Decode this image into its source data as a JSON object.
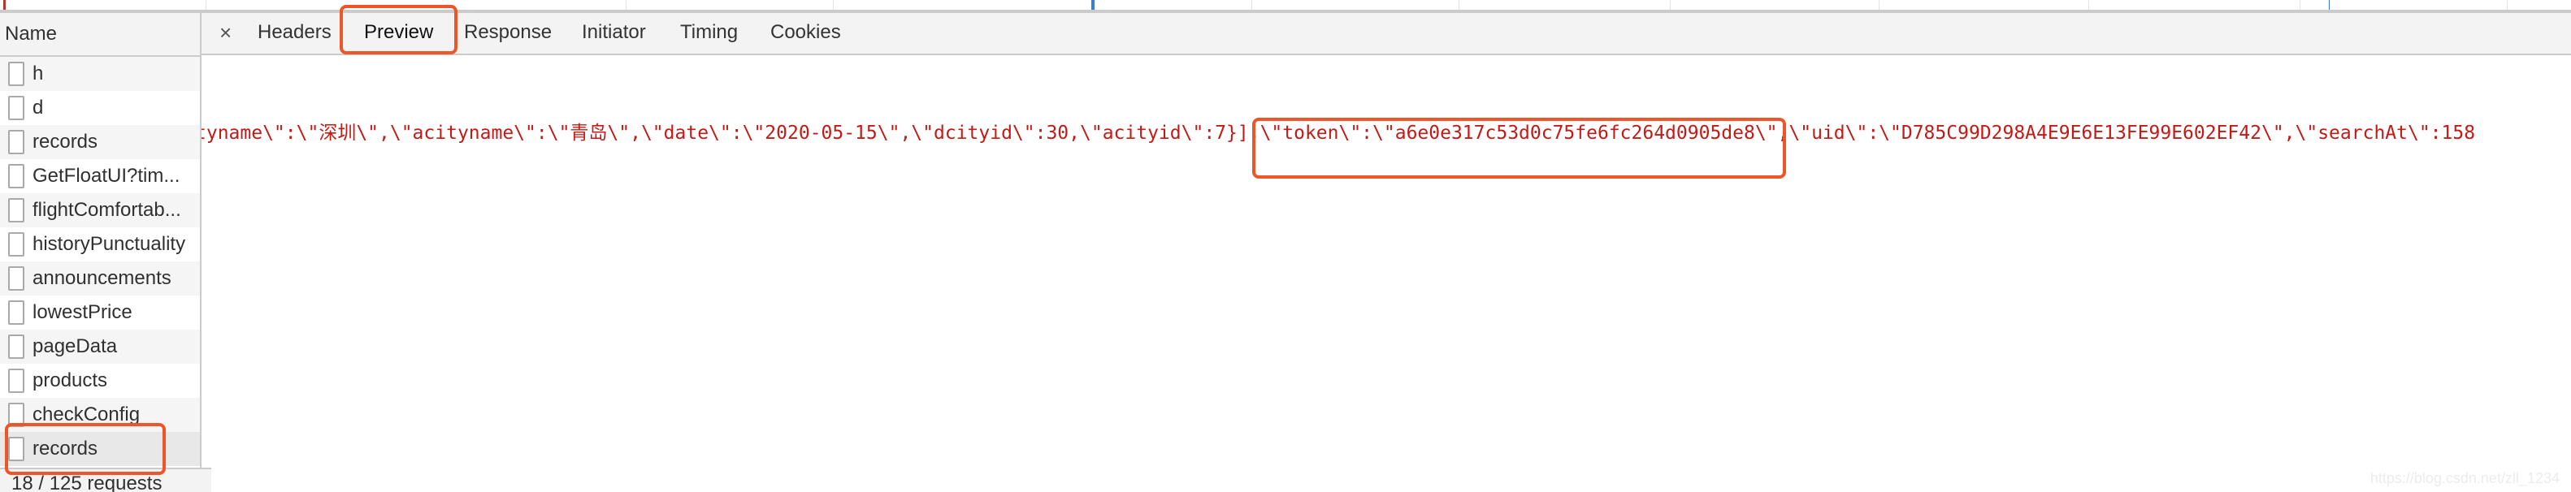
{
  "sidebar": {
    "header": "Name",
    "items": [
      {
        "label": "h"
      },
      {
        "label": "d"
      },
      {
        "label": "records"
      },
      {
        "label": "GetFloatUI?tim..."
      },
      {
        "label": "flightComfortab..."
      },
      {
        "label": "historyPunctuality"
      },
      {
        "label": "announcements"
      },
      {
        "label": "lowestPrice"
      },
      {
        "label": "pageData"
      },
      {
        "label": "products"
      },
      {
        "label": "checkConfig"
      },
      {
        "label": "records",
        "selected": true
      }
    ],
    "footer": "18 / 125 requests"
  },
  "tabs": {
    "close": "×",
    "items": [
      {
        "label": "Headers"
      },
      {
        "label": "Preview",
        "active": true
      },
      {
        "label": "Response"
      },
      {
        "label": "Initiator"
      },
      {
        "label": "Timing"
      },
      {
        "label": "Cookies"
      }
    ]
  },
  "preview": {
    "before": "tyname\\\":\\\"深圳\\\",\\\"acityname\\\":\\\"青岛\\\",\\\"date\\\":\\\"2020-05-15\\\",\\\"dcityid\\\":30,\\\"acityid\\\":7}],",
    "token": "\\\"token\\\":\\\"a6e0e317c53d0c75fe6fc264d0905de8\\\"",
    "after": ",\\\"uid\\\":\\\"D785C99D298A4E9E6E13FE99E602EF42\\\",\\\"searchAt\\\":158"
  },
  "watermark": "https://blog.csdn.net/zll_1234",
  "colors": {
    "highlight": "#ee5528",
    "json_string": "#c41a16"
  }
}
